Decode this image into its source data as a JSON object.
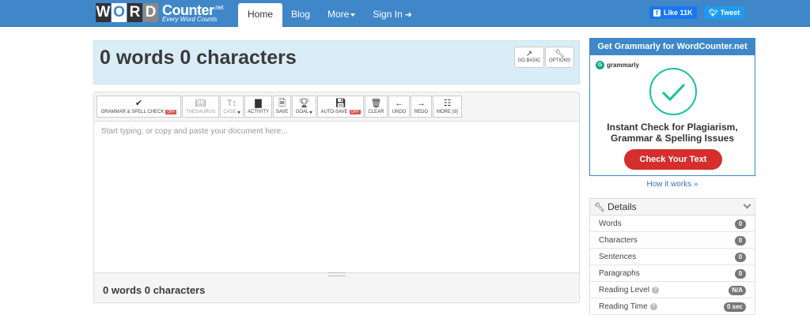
{
  "logo": {
    "letters": [
      "W",
      "O",
      "R",
      "D"
    ],
    "main": "Counter",
    "tld": ".net",
    "tagline": "Every Word Counts"
  },
  "nav": {
    "items": [
      {
        "label": "Home",
        "active": true
      },
      {
        "label": "Blog"
      },
      {
        "label": "More"
      },
      {
        "label": "Sign In"
      }
    ]
  },
  "social": {
    "like": "Like 11K",
    "tweet": "Tweet"
  },
  "counter": {
    "title": "0 words 0 characters",
    "go_basic": "GO BASIC",
    "options": "OPTIONS"
  },
  "toolbar": {
    "grammar": "GRAMMAR & SPELL CHECK",
    "grammar_state": "OFF",
    "thesaurus": "THESAURUS",
    "case": "CASE",
    "activity": "ACTIVITY",
    "save": "SAVE",
    "goal": "GOAL",
    "autosave": "AUTO-SAVE",
    "autosave_state": "OFF",
    "clear": "CLEAR",
    "undo": "UNDO",
    "redo": "REDO",
    "more": "MORE (9)"
  },
  "editor": {
    "placeholder": "Start typing, or copy and paste your document here..."
  },
  "bottom": {
    "count": "0 words 0 characters"
  },
  "ad": {
    "header": "Get Grammarly for WordCounter.net",
    "brand": "grammarly",
    "line1": "Instant Check for Plagiarism,",
    "line2": "Grammar & Spelling Issues",
    "cta": "Check Your Text",
    "how": "How it works »"
  },
  "details": {
    "title": "Details",
    "rows": [
      {
        "label": "Words",
        "value": "0"
      },
      {
        "label": "Characters",
        "value": "0"
      },
      {
        "label": "Sentences",
        "value": "0"
      },
      {
        "label": "Paragraphs",
        "value": "0"
      },
      {
        "label": "Reading Level",
        "value": "N/A"
      },
      {
        "label": "Reading Time",
        "value": "0 sec"
      }
    ]
  },
  "colors": {
    "brand": "#3f87c9",
    "header_bg": "#d9edf7",
    "cta": "#d62d2d",
    "grammarly": "#15c39a"
  }
}
